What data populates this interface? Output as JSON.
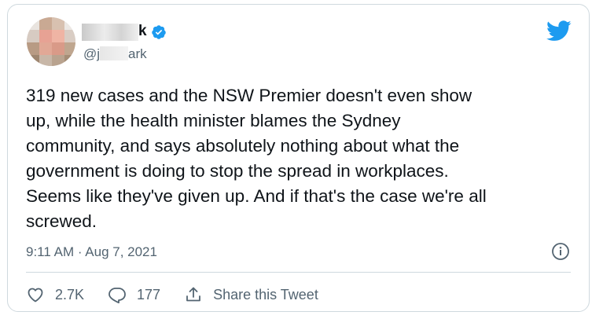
{
  "tweet": {
    "display_name": "k",
    "handle": "@j ark",
    "handle_visible_start": "@j",
    "handle_visible_end": "ark",
    "verified": true,
    "text": "319 new cases and the NSW Premier doesn't even show\nup, while the health minister blames the Sydney\ncommunity, and says absolutely nothing about what the\ngovernment is doing to stop the spread in workplaces.\nSeems like they've given up. And if that's the case we're all\nscrewed.",
    "timestamp": "9:11 AM · Aug 7, 2021"
  },
  "actions": {
    "like_count": "2.7K",
    "reply_count": "177",
    "share_label": "Share this Tweet"
  },
  "icons": {
    "brand": "twitter-bird-icon",
    "verified": "verified-badge-icon",
    "info": "info-icon",
    "like": "heart-icon",
    "reply": "reply-bubble-icon",
    "share": "share-icon"
  },
  "colors": {
    "brand": "#1d9bf0",
    "text": "#0f1419",
    "secondary": "#536471",
    "border": "#cfd9de"
  }
}
